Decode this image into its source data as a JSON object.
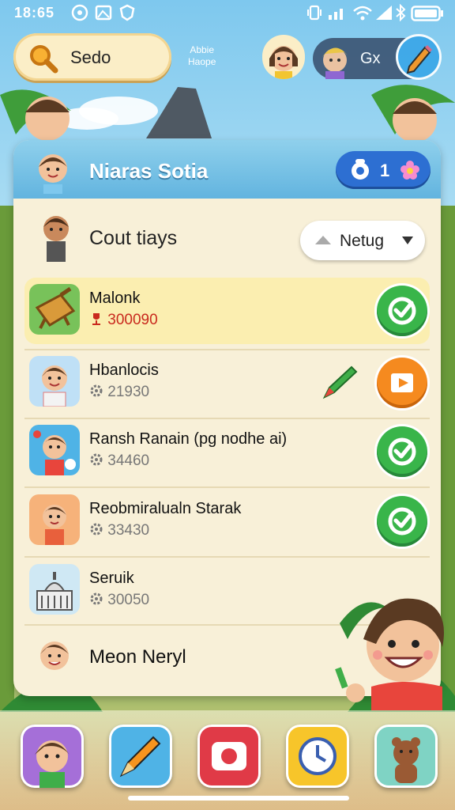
{
  "status_bar": {
    "time": "18:65"
  },
  "top_bar": {
    "search_label": "Sedo",
    "small_text_line1": "Abbie",
    "small_text_line2": "Haope",
    "profile_label": "Gx"
  },
  "panel": {
    "title": "Niaras Sotia",
    "badge_count": "1",
    "section_title": "Cout tiays",
    "sort_label": "Netug",
    "items": [
      {
        "name": "Malonk",
        "score": "300090",
        "action": "check"
      },
      {
        "name": "Hbanlocis",
        "score": "21930",
        "action": "play"
      },
      {
        "name": "Ransh Ranain (pg nodhe ai)",
        "score": "34460",
        "action": "check"
      },
      {
        "name": "Reobmiralualn Starak",
        "score": "33430",
        "action": "check"
      },
      {
        "name": "Seruik",
        "score": "30050",
        "action": "check"
      },
      {
        "name": "Meon Neryl"
      }
    ]
  },
  "colors": {
    "accent_blue": "#2d6fd2",
    "accent_green": "#39b54a",
    "accent_orange": "#f58a1f",
    "score_red": "#c92a1e"
  }
}
